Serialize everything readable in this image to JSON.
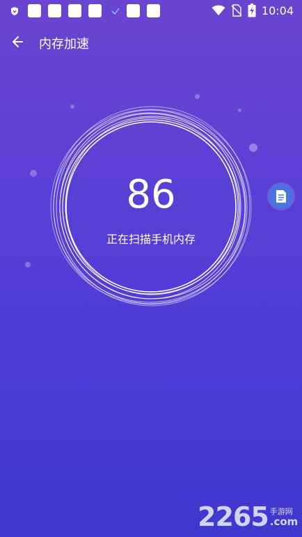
{
  "status_bar": {
    "time": "10:04",
    "icons": [
      "shield-icon",
      "notification-square",
      "notification-square",
      "notification-square",
      "notification-square",
      "check-icon",
      "notification-square",
      "notification-square",
      "wifi-icon",
      "no-sim-icon",
      "battery-charging-icon"
    ]
  },
  "app_bar": {
    "back_icon": "back-arrow-icon",
    "title": "内存加速"
  },
  "scan": {
    "value": "86",
    "status": "正在扫描手机内存"
  },
  "float_button": {
    "icon": "document-icon"
  },
  "watermark": {
    "number": "2265",
    "site_cn": "手游网",
    "domain": ".com"
  },
  "colors": {
    "background_top": "#6a45cf",
    "background_bottom": "#3f37cf",
    "float_button": "#4a72e0",
    "text": "#ffffff"
  }
}
